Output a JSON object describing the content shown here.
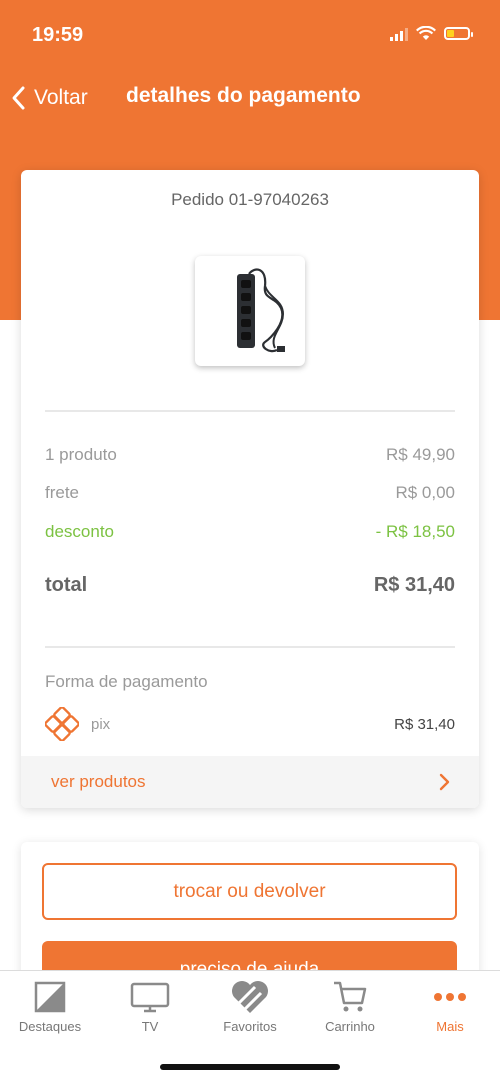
{
  "status": {
    "time": "19:59"
  },
  "nav": {
    "back_label": "Voltar",
    "title": "detalhes do pagamento"
  },
  "order": {
    "number": "Pedido 01-97040263",
    "product_icon": "power-strip-product-image"
  },
  "summary": {
    "products_label": "1 produto",
    "products_value": "R$ 49,90",
    "shipping_label": "frete",
    "shipping_value": "R$ 0,00",
    "discount_label": "desconto",
    "discount_value": "- R$ 18,50",
    "total_label": "total",
    "total_value": "R$ 31,40"
  },
  "payment": {
    "label": "Forma de pagamento",
    "method": "pix",
    "value": "R$ 31,40",
    "icon": "pix-icon"
  },
  "see_products": {
    "label": "ver produtos"
  },
  "actions": {
    "exchange_label": "trocar ou devolver",
    "help_label": "preciso de ajuda"
  },
  "tabs": [
    {
      "label": "Destaques",
      "icon": "highlights-icon"
    },
    {
      "label": "TV",
      "icon": "tv-icon"
    },
    {
      "label": "Favoritos",
      "icon": "heart-icon"
    },
    {
      "label": "Carrinho",
      "icon": "cart-icon"
    },
    {
      "label": "Mais",
      "icon": "more-icon",
      "active": true
    }
  ],
  "colors": {
    "brand": "#ef7533",
    "discount": "#7cc242"
  }
}
